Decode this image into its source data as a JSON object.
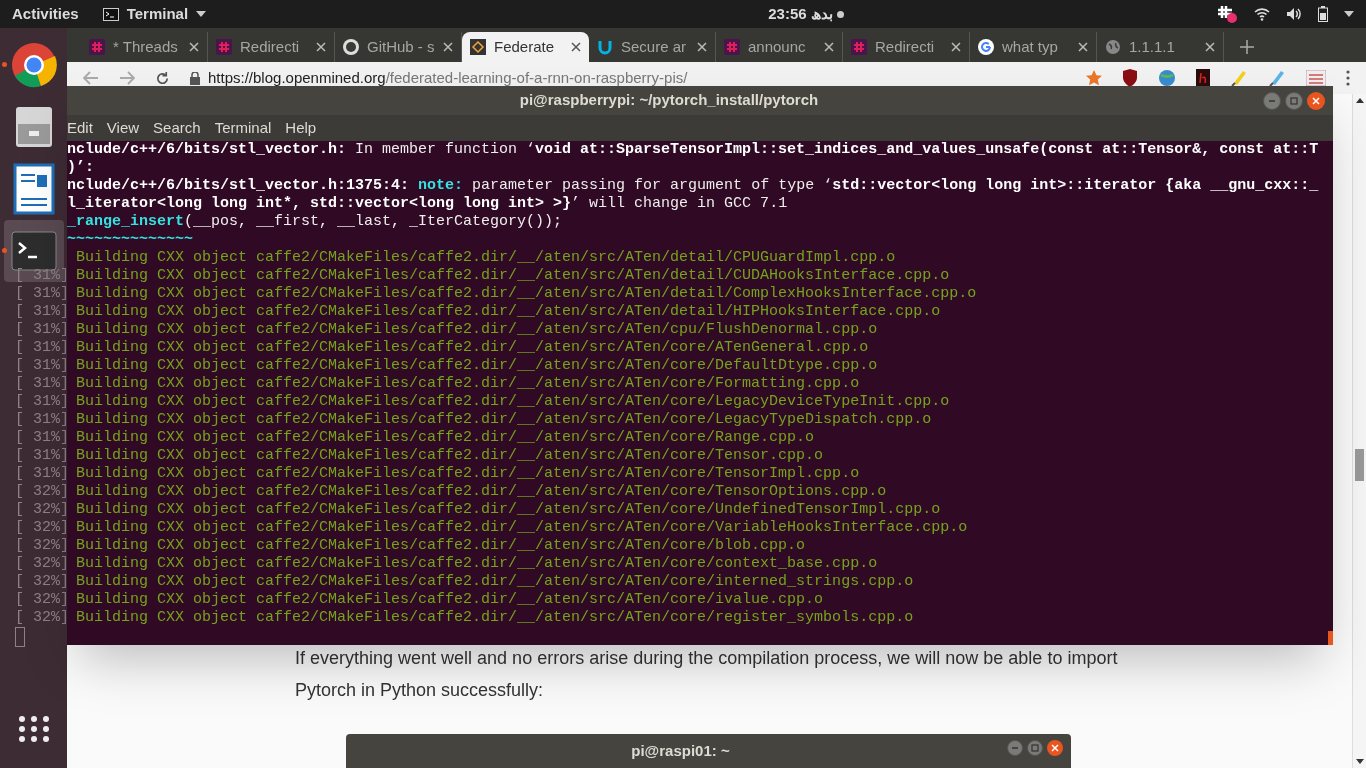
{
  "top_bar": {
    "activities": "Activities",
    "app_menu": "Terminal",
    "clock": "23:56 بدھ"
  },
  "dock": {
    "items": [
      {
        "kind": "browser",
        "running": true,
        "selected": false
      },
      {
        "kind": "files",
        "running": false,
        "selected": false
      },
      {
        "kind": "writer",
        "running": false,
        "selected": false
      },
      {
        "kind": "terminal",
        "running": true,
        "selected": true
      }
    ]
  },
  "browser": {
    "tabs": [
      {
        "label": "* Threads",
        "kind": "slack",
        "selected": false
      },
      {
        "label": "Redirecti",
        "kind": "slack",
        "selected": false
      },
      {
        "label": "GitHub - s",
        "kind": "github",
        "selected": false
      },
      {
        "label": "Federate",
        "kind": "openmined",
        "selected": true
      },
      {
        "label": "Secure ar",
        "kind": "udacity",
        "selected": false
      },
      {
        "label": "announc",
        "kind": "slack",
        "selected": false
      },
      {
        "label": "Redirecti",
        "kind": "slack",
        "selected": false
      },
      {
        "label": "what typ",
        "kind": "google",
        "selected": false
      },
      {
        "label": "1.1.1.1",
        "kind": "globe",
        "selected": false
      }
    ],
    "url": {
      "host": "https://blog.openmined.org",
      "path": "/federated-learning-of-a-rnn-on-raspberry-pis/"
    },
    "article": [
      "If everything went well and no errors arise during the compilation process, we will now be able to import",
      "Pytorch in Python successfully:"
    ]
  },
  "terminal": {
    "title": "pi@raspberrypi: ~/pytorch_install/pytorch",
    "menus": [
      "Edit",
      "View",
      "Search",
      "Terminal",
      "Help"
    ],
    "lines": [
      {
        "segments": [
          {
            "kind": "bold",
            "text": "nclude/c++/6/bits/stl_vector.h:"
          },
          {
            "kind": "plain",
            "text": " In member function ‘"
          },
          {
            "kind": "bold",
            "text": "void at::SparseTensorImpl::set_indices_and_values_unsafe(const at::Tensor&, const at::T"
          }
        ]
      },
      {
        "segments": [
          {
            "kind": "bold",
            "text": ")’:"
          }
        ]
      },
      {
        "segments": [
          {
            "kind": "bold",
            "text": "nclude/c++/6/bits/stl_vector.h:1375:4:"
          },
          {
            "kind": "note",
            "text": "note:"
          },
          {
            "kind": "plain",
            "text": " parameter passing for argument of type ‘"
          },
          {
            "kind": "bold",
            "text": "std::vector<long long int>::iterator {aka __gnu_cxx::_"
          }
        ]
      },
      {
        "segments": [
          {
            "kind": "bold",
            "text": "l_iterator<long long int*, std::vector<long long int> >}"
          },
          {
            "kind": "plain",
            "text": "’ will change in GCC 7.1"
          }
        ]
      },
      {
        "segments": [
          {
            "kind": "func",
            "text": "_range_insert"
          },
          {
            "kind": "plain",
            "text": "(__pos, __first, __last, _IterCategory());"
          }
        ]
      },
      {
        "segments": [
          {
            "kind": "func",
            "text": "~~~~~~~~~~~~~~"
          }
        ]
      },
      {
        "segments": [
          {
            "kind": "build",
            "text": " Building CXX object caffe2/CMakeFiles/caffe2.dir/__/aten/src/ATen/detail/CPUGuardImpl.cpp.o"
          }
        ]
      },
      {
        "prefix": "[ 31%]",
        "segments": [
          {
            "kind": "build",
            "text": " Building CXX object caffe2/CMakeFiles/caffe2.dir/__/aten/src/ATen/detail/CUDAHooksInterface.cpp.o"
          }
        ]
      },
      {
        "prefix": "[ 31%]",
        "segments": [
          {
            "kind": "build",
            "text": " Building CXX object caffe2/CMakeFiles/caffe2.dir/__/aten/src/ATen/detail/ComplexHooksInterface.cpp.o"
          }
        ]
      },
      {
        "prefix": "[ 31%]",
        "segments": [
          {
            "kind": "build",
            "text": " Building CXX object caffe2/CMakeFiles/caffe2.dir/__/aten/src/ATen/detail/HIPHooksInterface.cpp.o"
          }
        ]
      },
      {
        "prefix": "[ 31%]",
        "segments": [
          {
            "kind": "build",
            "text": " Building CXX object caffe2/CMakeFiles/caffe2.dir/__/aten/src/ATen/cpu/FlushDenormal.cpp.o"
          }
        ]
      },
      {
        "prefix": "[ 31%]",
        "segments": [
          {
            "kind": "build",
            "text": " Building CXX object caffe2/CMakeFiles/caffe2.dir/__/aten/src/ATen/core/ATenGeneral.cpp.o"
          }
        ]
      },
      {
        "prefix": "[ 31%]",
        "segments": [
          {
            "kind": "build",
            "text": " Building CXX object caffe2/CMakeFiles/caffe2.dir/__/aten/src/ATen/core/DefaultDtype.cpp.o"
          }
        ]
      },
      {
        "prefix": "[ 31%]",
        "segments": [
          {
            "kind": "build",
            "text": " Building CXX object caffe2/CMakeFiles/caffe2.dir/__/aten/src/ATen/core/Formatting.cpp.o"
          }
        ]
      },
      {
        "prefix": "[ 31%]",
        "segments": [
          {
            "kind": "build",
            "text": " Building CXX object caffe2/CMakeFiles/caffe2.dir/__/aten/src/ATen/core/LegacyDeviceTypeInit.cpp.o"
          }
        ]
      },
      {
        "prefix": "[ 31%]",
        "segments": [
          {
            "kind": "build",
            "text": " Building CXX object caffe2/CMakeFiles/caffe2.dir/__/aten/src/ATen/core/LegacyTypeDispatch.cpp.o"
          }
        ]
      },
      {
        "prefix": "[ 31%]",
        "segments": [
          {
            "kind": "build",
            "text": " Building CXX object caffe2/CMakeFiles/caffe2.dir/__/aten/src/ATen/core/Range.cpp.o"
          }
        ]
      },
      {
        "prefix": "[ 31%]",
        "segments": [
          {
            "kind": "build",
            "text": " Building CXX object caffe2/CMakeFiles/caffe2.dir/__/aten/src/ATen/core/Tensor.cpp.o"
          }
        ]
      },
      {
        "prefix": "[ 31%]",
        "segments": [
          {
            "kind": "build",
            "text": " Building CXX object caffe2/CMakeFiles/caffe2.dir/__/aten/src/ATen/core/TensorImpl.cpp.o"
          }
        ]
      },
      {
        "prefix": "[ 32%]",
        "segments": [
          {
            "kind": "build",
            "text": " Building CXX object caffe2/CMakeFiles/caffe2.dir/__/aten/src/ATen/core/TensorOptions.cpp.o"
          }
        ]
      },
      {
        "prefix": "[ 32%]",
        "segments": [
          {
            "kind": "build",
            "text": " Building CXX object caffe2/CMakeFiles/caffe2.dir/__/aten/src/ATen/core/UndefinedTensorImpl.cpp.o"
          }
        ]
      },
      {
        "prefix": "[ 32%]",
        "segments": [
          {
            "kind": "build",
            "text": " Building CXX object caffe2/CMakeFiles/caffe2.dir/__/aten/src/ATen/core/VariableHooksInterface.cpp.o"
          }
        ]
      },
      {
        "prefix": "[ 32%]",
        "segments": [
          {
            "kind": "build",
            "text": " Building CXX object caffe2/CMakeFiles/caffe2.dir/__/aten/src/ATen/core/blob.cpp.o"
          }
        ]
      },
      {
        "prefix": "[ 32%]",
        "segments": [
          {
            "kind": "build",
            "text": " Building CXX object caffe2/CMakeFiles/caffe2.dir/__/aten/src/ATen/core/context_base.cpp.o"
          }
        ]
      },
      {
        "prefix": "[ 32%]",
        "segments": [
          {
            "kind": "build",
            "text": " Building CXX object caffe2/CMakeFiles/caffe2.dir/__/aten/src/ATen/core/interned_strings.cpp.o"
          }
        ]
      },
      {
        "prefix": "[ 32%]",
        "segments": [
          {
            "kind": "build",
            "text": " Building CXX object caffe2/CMakeFiles/caffe2.dir/__/aten/src/ATen/core/ivalue.cpp.o"
          }
        ]
      },
      {
        "prefix": "[ 32%]",
        "segments": [
          {
            "kind": "build",
            "text": " Building CXX object caffe2/CMakeFiles/caffe2.dir/__/aten/src/ATen/core/register_symbols.cpp.o"
          }
        ]
      }
    ]
  },
  "second_terminal": {
    "title": "pi@raspi01: ~"
  }
}
